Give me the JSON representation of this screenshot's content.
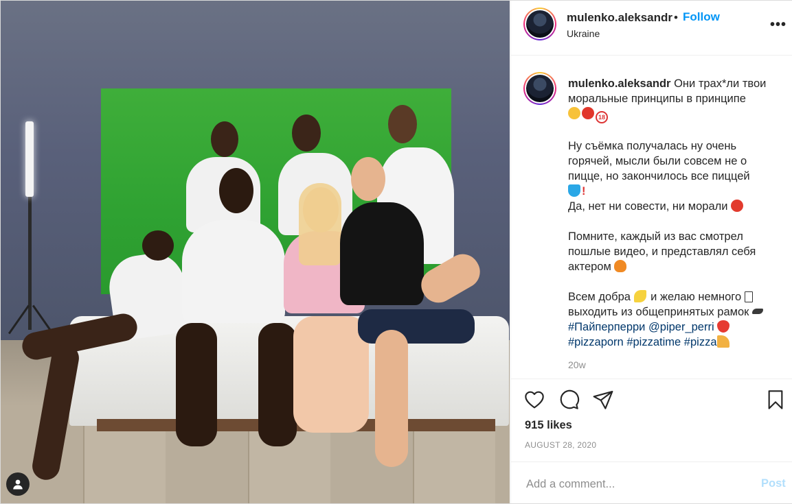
{
  "post": {
    "username": "mulenko.aleksandr",
    "dot": "•",
    "follow_label": "Follow",
    "location": "Ukraine",
    "more_label": "•••"
  },
  "caption": {
    "username": "mulenko.aleksandr",
    "line1": "Они трах*ли твои моральные принципы в принципе",
    "para2": "Ну съёмка получалась ну очень горячей, мысли были совсем не о пицце, но закончилось все пиццей",
    "line3": "Да, нет ни совести, ни морали",
    "para4": "Помните, каждый из вас смотрел пошлые видео, и представлял себя актером",
    "para5_a": "Всем добра",
    "para5_b": "и желаю немного",
    "para5_c": "выходить из общепринятых рамок",
    "hashtag1": "#Пайперперри",
    "mention1": "@piper_perri",
    "hashtag2": "#pizzaporn",
    "hashtag3": "#pizzatime",
    "hashtag4": "#pizza",
    "emoji_18_label": "18",
    "time_ago": "20w"
  },
  "actions": {
    "like_icon": "heart-icon",
    "comment_icon": "comment-icon",
    "share_icon": "paper-plane-icon",
    "save_icon": "bookmark-icon",
    "likes": "915 likes",
    "date": "AUGUST 28, 2020"
  },
  "comment": {
    "placeholder": "Add a comment...",
    "post_label": "Post"
  },
  "colors": {
    "accent": "#0095f6",
    "post_disabled": "#b2dffc",
    "hashtag": "#00376b",
    "muted": "#8e8e8e"
  }
}
